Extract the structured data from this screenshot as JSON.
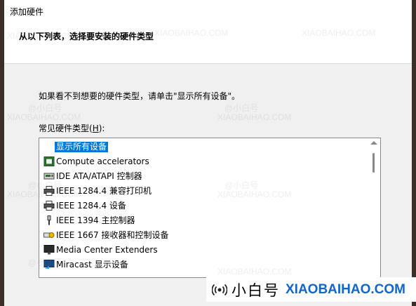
{
  "window": {
    "title": "添加硬件"
  },
  "header": {
    "heading": "从以下列表，选择要安装的硬件类型"
  },
  "main": {
    "instruction": "如果看不到想要的硬件类型，请单击\"显示所有设备\"。",
    "list_label_prefix": "常见硬件类型(",
    "list_label_accel": "H",
    "list_label_suffix": "):"
  },
  "hardware_list": {
    "items": [
      {
        "label": "显示所有设备",
        "icon": "none",
        "selected": true
      },
      {
        "label": "Compute accelerators",
        "icon": "chip-icon"
      },
      {
        "label": "IDE ATA/ATAPI 控制器",
        "icon": "drive-controller-icon"
      },
      {
        "label": "IEEE 1284.4 兼容打印机",
        "icon": "printer-icon"
      },
      {
        "label": "IEEE 1284.4 设备",
        "icon": "printer-icon"
      },
      {
        "label": "IEEE 1394 主控制器",
        "icon": "usb-plug-icon"
      },
      {
        "label": "IEEE 1667 接收器和控制设备",
        "icon": "key-device-icon"
      },
      {
        "label": "Media Center Extenders",
        "icon": "monitor-icon"
      },
      {
        "label": "Miracast 显示设备",
        "icon": "miracast-icon"
      }
    ]
  },
  "watermark": {
    "brand_cn": "小白号",
    "brand_en": "XIAOBAIHAO.COM",
    "small_cn": "@小白号"
  },
  "colors": {
    "selection": "#0078d7",
    "brand_blue": "#1166cc"
  }
}
